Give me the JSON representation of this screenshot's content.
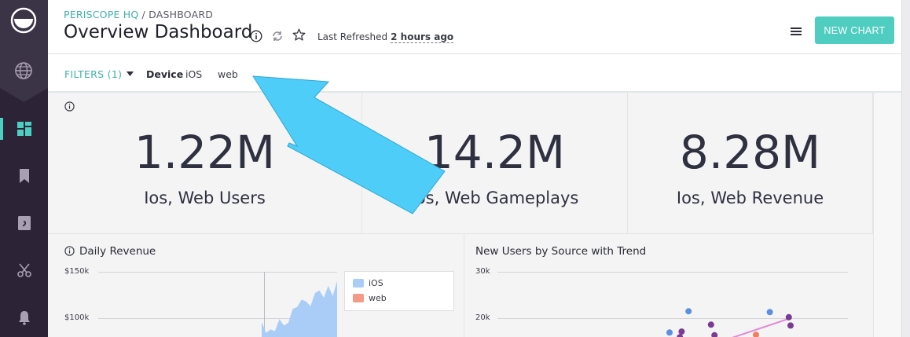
{
  "header": {
    "breadcrumb_org": "PERISCOPE HQ",
    "breadcrumb_sep": " / ",
    "breadcrumb_page": "DASHBOARD",
    "title": "Overview Dashboard",
    "last_refreshed_label": "Last Refreshed",
    "last_refreshed_value": "2 hours ago",
    "new_chart_label": "NEW CHART"
  },
  "filters": {
    "label": "FILTERS (1)",
    "device_label": "Device",
    "options": [
      "iOS",
      "web"
    ]
  },
  "kpis": [
    {
      "value": "1.22M",
      "label": "Ios, Web Users"
    },
    {
      "value": "14.2M",
      "label": "Ios, Web Gameplays"
    },
    {
      "value": "8.28M",
      "label": "Ios, Web Revenue"
    }
  ],
  "daily_revenue": {
    "title": "Daily Revenue",
    "legend": [
      "iOS",
      "web"
    ],
    "colors": {
      "iOS": "#a9cdf7",
      "web": "#f59a86"
    }
  },
  "new_users": {
    "title": "New Users by Source with Trend"
  },
  "chart_data": [
    {
      "type": "area",
      "title": "Daily Revenue",
      "xlabel": "",
      "ylabel": "",
      "y_ticks": [
        "$150k",
        "$100k"
      ],
      "y_tick_values": [
        150000,
        100000
      ],
      "ylim": [
        0,
        160000
      ],
      "legend_placement": "top-right",
      "series": [
        {
          "name": "iOS",
          "values": [
            96000,
            84000,
            88000,
            86000,
            99000,
            92000,
            95000,
            110000,
            112000,
            120000,
            118000,
            113000,
            127000,
            130000,
            122000,
            135000,
            124000,
            140000
          ]
        },
        {
          "name": "web",
          "values": []
        }
      ]
    },
    {
      "type": "scatter",
      "title": "New Users by Source with Trend",
      "y_ticks": [
        "30k",
        "20k"
      ],
      "y_tick_values": [
        30000,
        20000
      ],
      "ylim": [
        0,
        32000
      ],
      "points": [
        {
          "x": 0.05,
          "y": 16900,
          "color": "#5b8fe0"
        },
        {
          "x": 0.16,
          "y": 21500,
          "color": "#5b8fe0"
        },
        {
          "x": 0.12,
          "y": 17100,
          "color": "#7b3a94"
        },
        {
          "x": 0.11,
          "y": 15900,
          "color": "#7b3a94"
        },
        {
          "x": 0.29,
          "y": 18600,
          "color": "#7b3a94"
        },
        {
          "x": 0.31,
          "y": 16300,
          "color": "#7b3a94"
        },
        {
          "x": 0.55,
          "y": 16400,
          "color": "#f27d5e"
        },
        {
          "x": 0.63,
          "y": 21300,
          "color": "#5b8fe0"
        },
        {
          "x": 0.74,
          "y": 20200,
          "color": "#7b3a94"
        },
        {
          "x": 0.75,
          "y": 18400,
          "color": "#7b3a94"
        }
      ],
      "trend": [
        [
          0.35,
          15000
        ],
        [
          0.75,
          20000
        ]
      ]
    }
  ]
}
